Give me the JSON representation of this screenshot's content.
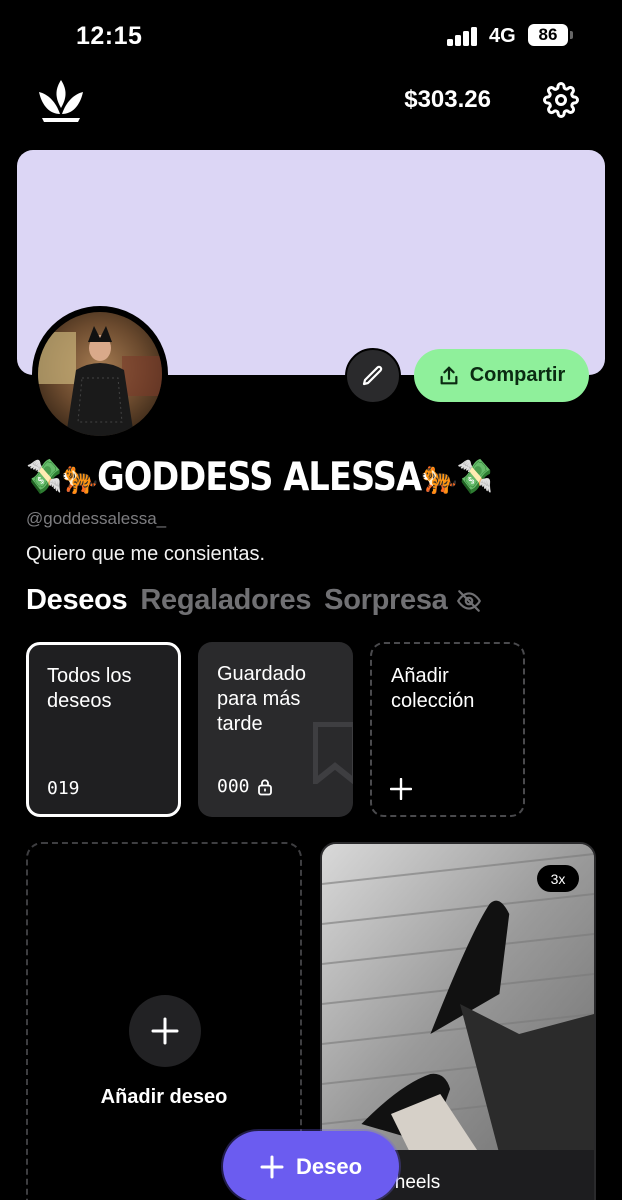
{
  "status_bar": {
    "time": "12:15",
    "network": "4G",
    "battery": "86"
  },
  "header": {
    "balance": "$303.26"
  },
  "actions": {
    "share_label": "Compartir"
  },
  "profile": {
    "name_prefix_emoji": "💸🐅",
    "name": "GODDESS ALESSA",
    "name_suffix_emoji": "🐅💸",
    "handle": "@goddessalessa_",
    "bio": "Quiero que me consientas."
  },
  "tabs": [
    {
      "label": "Deseos",
      "active": true
    },
    {
      "label": "Regaladores",
      "active": false
    },
    {
      "label": "Sorpresa",
      "active": false
    }
  ],
  "collections": [
    {
      "title": "Todos los deseos",
      "count": "019"
    },
    {
      "title": "Guardado para más tarde",
      "count": "000"
    },
    {
      "title": "Añadir colección"
    }
  ],
  "wishes": {
    "add_label": "Añadir deseo",
    "product": {
      "quantity": "3x",
      "title_visible": "y heels"
    }
  },
  "fab": {
    "label": "Deseo"
  },
  "colors": {
    "accent": "#6b5cf0",
    "share": "#8ff09b",
    "banner": "#dcd6f5",
    "background": "#000000"
  }
}
